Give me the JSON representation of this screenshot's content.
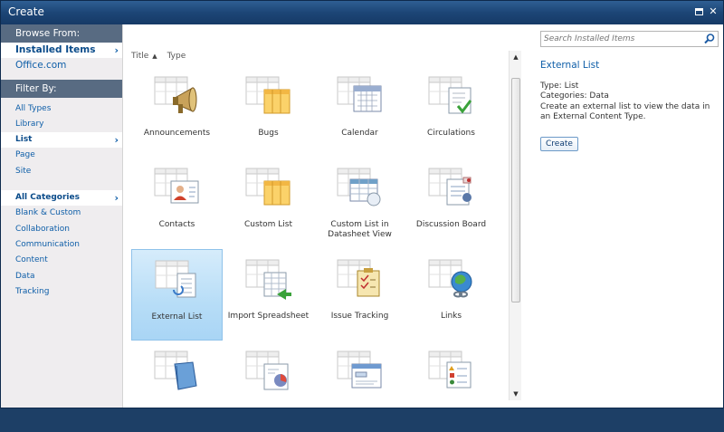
{
  "window": {
    "title": "Create"
  },
  "nav": {
    "browse_header": "Browse From:",
    "browse_items": [
      {
        "label": "Installed Items",
        "selected": true
      },
      {
        "label": "Office.com",
        "selected": false
      }
    ],
    "filter_header": "Filter By:",
    "type_items": [
      {
        "label": "All Types",
        "selected": false
      },
      {
        "label": "Library",
        "selected": false
      },
      {
        "label": "List",
        "selected": true
      },
      {
        "label": "Page",
        "selected": false
      },
      {
        "label": "Site",
        "selected": false
      }
    ],
    "category_items": [
      {
        "label": "All Categories",
        "selected": true
      },
      {
        "label": "Blank & Custom",
        "selected": false
      },
      {
        "label": "Collaboration",
        "selected": false
      },
      {
        "label": "Communication",
        "selected": false
      },
      {
        "label": "Content",
        "selected": false
      },
      {
        "label": "Data",
        "selected": false
      },
      {
        "label": "Tracking",
        "selected": false
      }
    ]
  },
  "sort": {
    "title": "Title",
    "type": "Type"
  },
  "templates": [
    {
      "label": "Announcements",
      "icon": "megaphone-icon",
      "selected": false
    },
    {
      "label": "Bugs",
      "icon": "bugs-list-icon",
      "selected": false
    },
    {
      "label": "Calendar",
      "icon": "calendar-icon",
      "selected": false
    },
    {
      "label": "Circulations",
      "icon": "circulation-check-icon",
      "selected": false
    },
    {
      "label": "Contacts",
      "icon": "contact-card-icon",
      "selected": false
    },
    {
      "label": "Custom List",
      "icon": "custom-list-icon",
      "selected": false
    },
    {
      "label": "Custom List in Datasheet View",
      "icon": "datasheet-icon",
      "selected": false
    },
    {
      "label": "Discussion Board",
      "icon": "discussion-board-icon",
      "selected": false
    },
    {
      "label": "External List",
      "icon": "external-list-icon",
      "selected": true
    },
    {
      "label": "Import Spreadsheet",
      "icon": "import-spreadsheet-icon",
      "selected": false
    },
    {
      "label": "Issue Tracking",
      "icon": "issue-tracking-icon",
      "selected": false
    },
    {
      "label": "Links",
      "icon": "links-globe-icon",
      "selected": false
    },
    {
      "label": "",
      "icon": "book-icon",
      "selected": false
    },
    {
      "label": "",
      "icon": "survey-chart-icon",
      "selected": false
    },
    {
      "label": "",
      "icon": "tasks-window-icon",
      "selected": false
    },
    {
      "label": "",
      "icon": "shapes-list-icon",
      "selected": false
    }
  ],
  "search": {
    "placeholder": "Search Installed Items"
  },
  "details": {
    "title": "External List",
    "type_line": "Type: List",
    "categories_line": "Categories: Data",
    "description": "Create an external list to view the data in an External Content Type.",
    "create_label": "Create"
  },
  "colors": {
    "titlebar": "#1c4576",
    "nav_header": "#586b82",
    "link": "#0e5ea8",
    "selected_tile": "#b7ddf7"
  }
}
